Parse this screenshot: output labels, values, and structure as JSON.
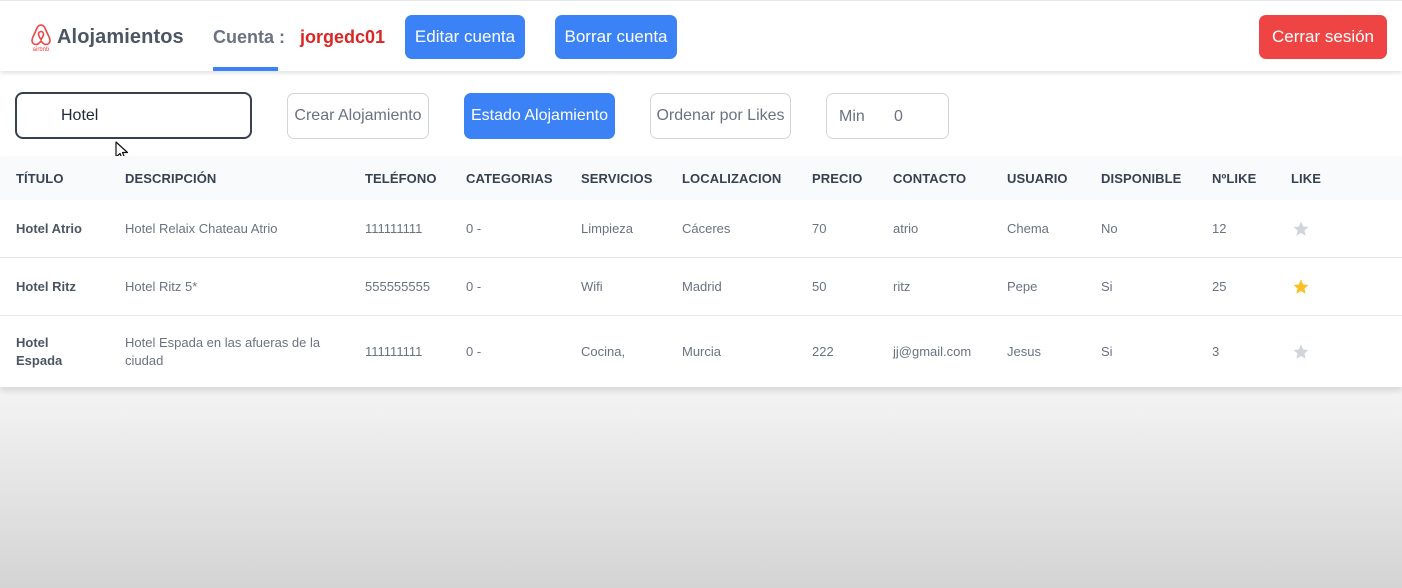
{
  "navbar": {
    "brand_icon": "airbnb-logo-icon",
    "brand_small_text": "airbnb",
    "brand_title": "Alojamientos",
    "account_tab": "Cuenta :",
    "username": "jorgedc01",
    "edit_button": "Editar cuenta",
    "delete_button": "Borrar cuenta",
    "logout_button": "Cerrar sesión",
    "colors": {
      "accent": "#3b82f6",
      "danger": "#ef4444",
      "username": "#dc2626"
    }
  },
  "toolbar": {
    "search_value": "Hotel",
    "create_button": "Crear Alojamiento",
    "state_button": "Estado Alojamiento",
    "sort_button": "Ordenar por Likes",
    "min_label": "Min",
    "min_value": "0"
  },
  "table": {
    "headers": [
      "TÍTULO",
      "DESCRIPCIÓN",
      "TELÉFONO",
      "CATEGORIAS",
      "SERVICIOS",
      "LOCALIZACION",
      "PRECIO",
      "CONTACTO",
      "USUARIO",
      "DISPONIBLE",
      "NºLIKE",
      "LIKE"
    ],
    "rows": [
      {
        "titulo": "Hotel Atrio",
        "descripcion": "Hotel Relaix Chateau Atrio",
        "telefono": "111111111",
        "categorias": "0 -",
        "servicios": "Limpieza",
        "localizacion": "Cáceres",
        "precio": "70",
        "contacto": "atrio",
        "usuario": "Chema",
        "disponible": "No",
        "likes": "12",
        "liked": false
      },
      {
        "titulo": "Hotel Ritz",
        "descripcion": "Hotel Ritz 5*",
        "telefono": "555555555",
        "categorias": "0 -",
        "servicios": "Wifi",
        "localizacion": "Madrid",
        "precio": "50",
        "contacto": "ritz",
        "usuario": "Pepe",
        "disponible": "Si",
        "likes": "25",
        "liked": true
      },
      {
        "titulo": "Hotel Espada",
        "descripcion": "Hotel Espada en las afueras de la ciudad",
        "telefono": "111111111",
        "categorias": "0 -",
        "servicios": "Cocina,",
        "localizacion": "Murcia",
        "precio": "222",
        "contacto": "jj@gmail.com",
        "usuario": "Jesus",
        "disponible": "Si",
        "likes": "3",
        "liked": false
      }
    ],
    "star_colors": {
      "liked": "#fbbf24",
      "unliked": "#d1d5db"
    }
  }
}
